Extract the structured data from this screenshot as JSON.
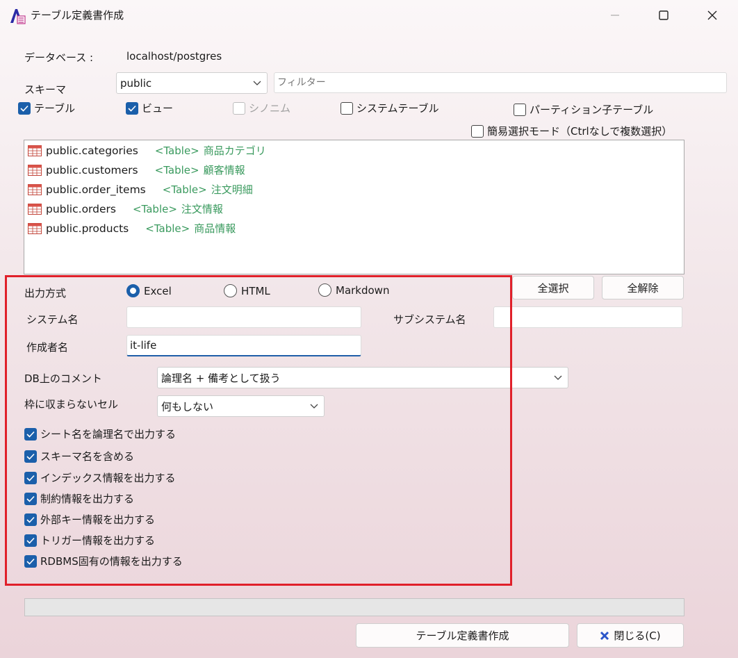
{
  "window": {
    "title": "テーブル定義書作成"
  },
  "database": {
    "label": "データベース :",
    "value": "localhost/postgres"
  },
  "schema": {
    "label": "スキーマ",
    "selected": "public",
    "filter_placeholder": "フィルター"
  },
  "filters": {
    "table": {
      "label": "テーブル",
      "checked": true
    },
    "view": {
      "label": "ビュー",
      "checked": true
    },
    "synonym": {
      "label": "シノニム",
      "checked": false,
      "disabled": true
    },
    "system_table": {
      "label": "システムテーブル",
      "checked": false
    },
    "partition_child": {
      "label": "パーティション子テーブル",
      "checked": false
    },
    "simple_select": {
      "label": "簡易選択モード（Ctrlなしで複数選択）",
      "checked": false
    }
  },
  "tables": [
    {
      "name": "public.categories",
      "type": "<Table>",
      "comment": "商品カテゴリ"
    },
    {
      "name": "public.customers",
      "type": "<Table>",
      "comment": "顧客情報"
    },
    {
      "name": "public.order_items",
      "type": "<Table>",
      "comment": "注文明細"
    },
    {
      "name": "public.orders",
      "type": "<Table>",
      "comment": "注文情報"
    },
    {
      "name": "public.products",
      "type": "<Table>",
      "comment": "商品情報"
    }
  ],
  "buttons": {
    "select_all": "全選択",
    "deselect_all": "全解除",
    "create": "テーブル定義書作成",
    "close": "閉じる(C)"
  },
  "output": {
    "label": "出力方式",
    "options": [
      "Excel",
      "HTML",
      "Markdown"
    ],
    "selected": "Excel"
  },
  "fields": {
    "system_name": {
      "label": "システム名",
      "value": ""
    },
    "subsystem_name": {
      "label": "サブシステム名",
      "value": ""
    },
    "author": {
      "label": "作成者名",
      "value": "it-life"
    }
  },
  "db_comment": {
    "label": "DB上のコメント",
    "selected": "論理名 + 備考として扱う"
  },
  "overflow_cell": {
    "label": "枠に収まらないセル",
    "selected": "何もしない"
  },
  "options": [
    {
      "label": "シート名を論理名で出力する",
      "checked": true
    },
    {
      "label": "スキーマ名を含める",
      "checked": true
    },
    {
      "label": "インデックス情報を出力する",
      "checked": true
    },
    {
      "label": "制約情報を出力する",
      "checked": true
    },
    {
      "label": "外部キー情報を出力する",
      "checked": true
    },
    {
      "label": "トリガー情報を出力する",
      "checked": true
    },
    {
      "label": "RDBMS固有の情報を出力する",
      "checked": true
    }
  ],
  "colors": {
    "accent": "#1b5faa",
    "highlight_border": "#e0202a",
    "table_comment": "#3a9a5e",
    "close_icon": "#2a55c9"
  }
}
